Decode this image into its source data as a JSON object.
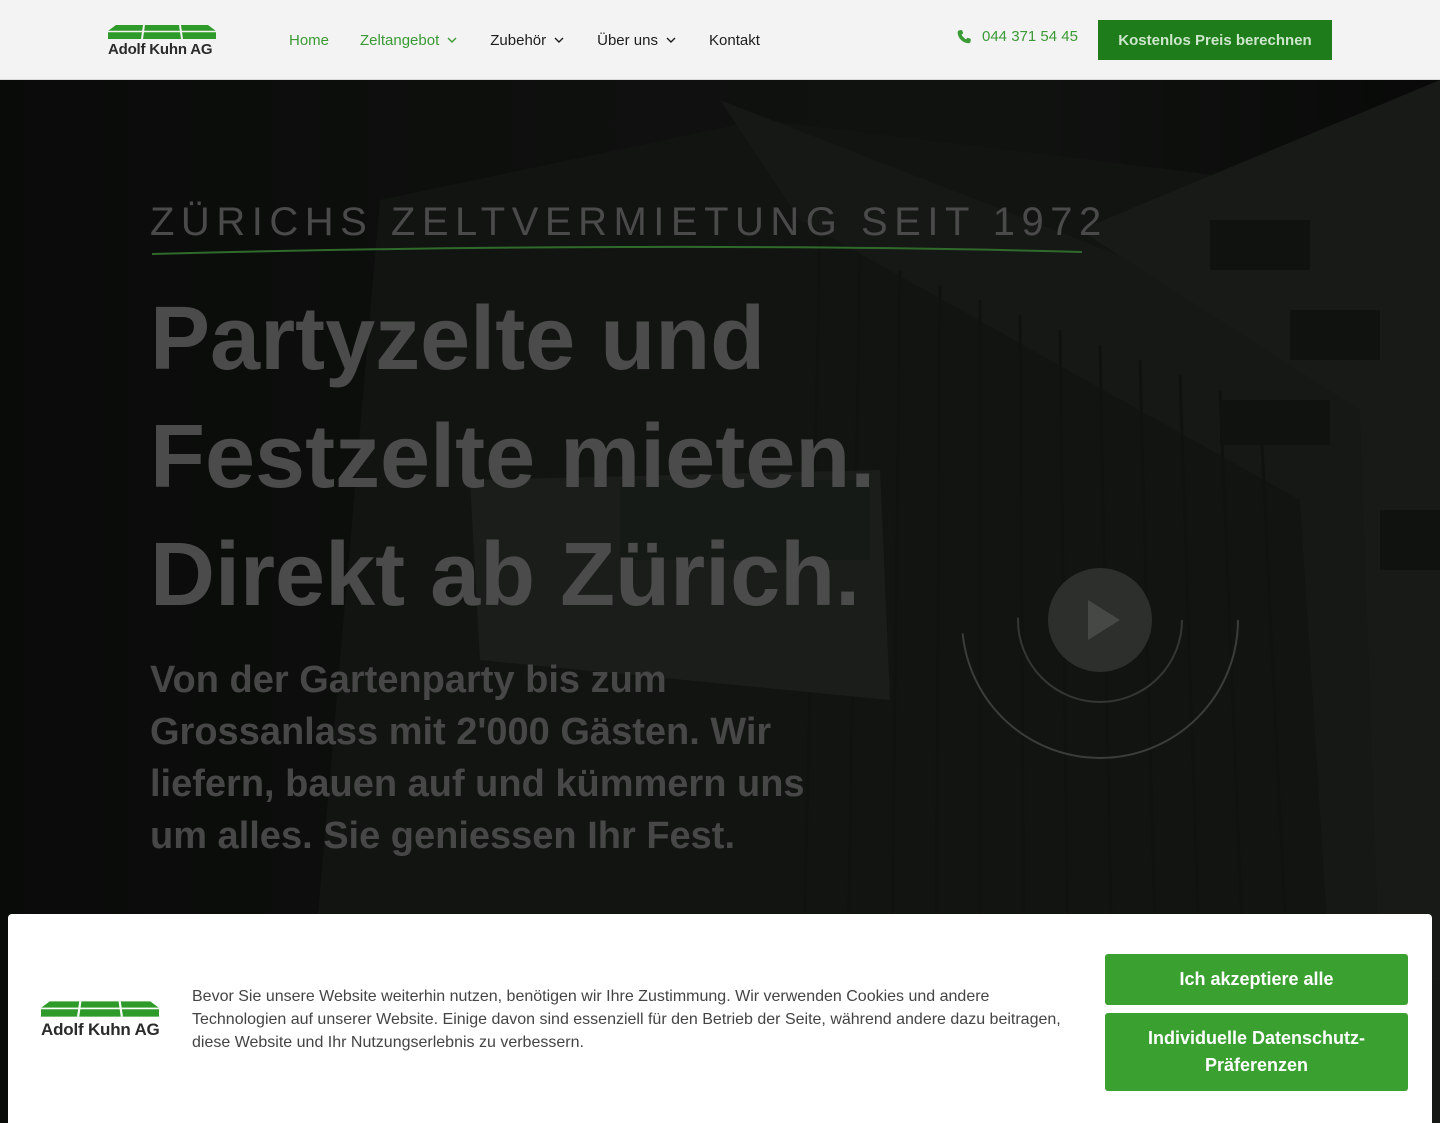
{
  "brand": {
    "name": "Adolf Kuhn AG",
    "green": "#3a9a34",
    "dark_green": "#1e7d1a"
  },
  "header": {
    "nav": [
      {
        "label": "Home",
        "active": true,
        "has_dropdown": false
      },
      {
        "label": "Zeltangebot",
        "active": true,
        "has_dropdown": true
      },
      {
        "label": "Zubehör",
        "active": false,
        "has_dropdown": true
      },
      {
        "label": "Über uns",
        "active": false,
        "has_dropdown": true
      },
      {
        "label": "Kontakt",
        "active": false,
        "has_dropdown": false
      }
    ],
    "phone": "044 371 54 45",
    "phone_icon": "phone-icon",
    "cta_label": "Kostenlos Preis berechnen"
  },
  "hero": {
    "eyebrow": "ZÜRICHS ZELTVERMIETUNG SEIT 1972",
    "headline": [
      "Partyzelte und",
      "Festzelte mieten.",
      "Direkt ab Zürich."
    ],
    "subhead": "Von der Gartenparty bis zum Grossanlass mit 2'000 Gästen. Wir liefern, bauen auf und kümmern uns um alles. Sie geniessen Ihr Fest.",
    "play_icon": "play-icon"
  },
  "cookie": {
    "text": "Bevor Sie unsere Website weiterhin nutzen, benötigen wir Ihre Zustimmung. Wir verwenden Cookies und andere Technologien auf unserer Website. Einige davon sind essenziell für den Betrieb der Seite, während andere dazu beitragen, diese Website und Ihr Nutzungserlebnis zu verbessern.",
    "accept_label": "Ich akzeptiere alle",
    "prefs_label": "Individuelle Datenschutz-Präferenzen"
  }
}
